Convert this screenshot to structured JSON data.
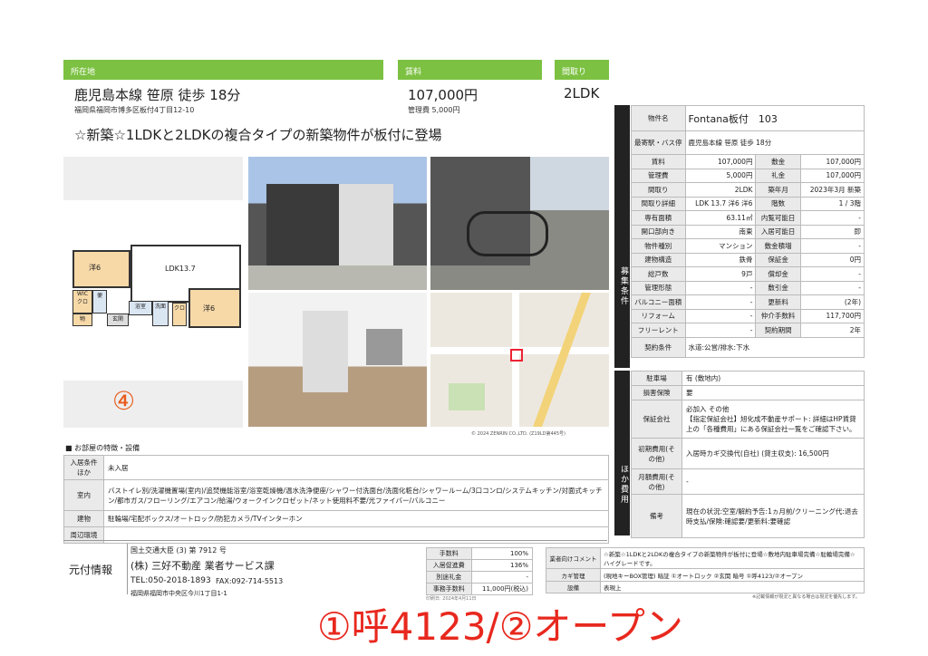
{
  "header": {
    "location_label": "所在地",
    "rent_label": "賃料",
    "layout_label": "間取り",
    "station": "鹿児島本線 笹原 徒歩 18分",
    "address": "福岡県福岡市博多区板付4丁目12-10",
    "rent": "107,000円",
    "admin_fee": "管理費 5,000円",
    "layout": "2LDK",
    "catch": "☆新築☆1LDKと2LDKの複合タイプの新築物件が板付に登場"
  },
  "plan": {
    "room1": "洋6",
    "room2": "LDK13.7",
    "room3": "洋6",
    "wic": "WIC",
    "wic2": "クロ",
    "bath": "浴室",
    "wash": "洗面",
    "toilet": "便",
    "storage": "物",
    "entrance": "玄関",
    "kuro": "クロ",
    "number": "④"
  },
  "map_caption": "© 2024 ZENRIN CO.,LTD. (Z19LD第445号)",
  "side": {
    "recruit": "募集条件",
    "other": "ほか費用"
  },
  "spec": {
    "name_label": "物件名",
    "name": "Fontana板付　103",
    "station_label": "最寄駅・バス停",
    "station": "鹿児島本線 笹原 徒歩 18分",
    "rows": [
      [
        "賃料",
        "107,000円",
        "敷金",
        "107,000円"
      ],
      [
        "管理費",
        "5,000円",
        "礼金",
        "107,000円"
      ],
      [
        "間取り",
        "2LDK",
        "築年月",
        "2023年3月 新築"
      ],
      [
        "間取り詳細",
        "LDK 13.7 洋6 洋6",
        "階数",
        "1 / 3階"
      ],
      [
        "専有面積",
        "63.11㎡",
        "内覧可能日",
        "-"
      ],
      [
        "開口部向き",
        "南東",
        "入居可能日",
        "即"
      ],
      [
        "物件種別",
        "マンション",
        "敷金積増",
        "-"
      ],
      [
        "建物構造",
        "鉄骨",
        "保証金",
        "0円"
      ],
      [
        "総戸数",
        "9戸",
        "償却金",
        "-"
      ],
      [
        "管理形態",
        "-",
        "敷引金",
        "-"
      ],
      [
        "バルコニー面積",
        "-",
        "更新料",
        "(2年)"
      ],
      [
        "リフォーム",
        "-",
        "仲介手数料",
        "117,700円"
      ],
      [
        "フリーレント",
        "-",
        "契約期間",
        "2年"
      ]
    ],
    "contract_label": "契約条件",
    "contract": "水道:公営/排水:下水"
  },
  "other": {
    "parking_label": "駐車場",
    "parking": "有 (敷地内)",
    "insurance_label": "損害保険",
    "insurance": "要",
    "guarantee_label": "保証会社",
    "guarantee": "必加入 その他\n【指定保証会社】旭化成不動産サポート: 詳細はHP賃貸上の「各種費用」にある保証会社一覧をご確認下さい。",
    "initial_label": "初期費用(その他)",
    "initial": "入居時カギ交換代(自社) (貸主収支): 16,500円",
    "monthly_label": "月額費用(その他)",
    "monthly": "-",
    "note_label": "備考",
    "note": "現在の状況:空室/解約予告:1ヵ月前/クリーニング代:退去時支払/保険:確認要/更新料:要確認"
  },
  "features": {
    "title": "■ お部屋の特徴・設備",
    "rows": [
      [
        "入居条件ほか",
        "未入居"
      ],
      [
        "室内",
        "バストイレ別/洗濯機置場(室内)/追焚機能浴室/浴室乾燥機/温水洗浄便座/シャワー付洗面台/洗面化粧台/シャワールーム/3口コンロ/システムキッチン/対面式キッチン/都市ガス/フローリング/エアコン/給湯/ウォークインクロゼット/ネット使用料不要/光ファイバー/バルコニー"
      ],
      [
        "建物",
        "駐輪場/宅配ボックス/オートロック/防犯カメラ/TVインターホン"
      ],
      [
        "周辺環境",
        ""
      ]
    ]
  },
  "agent": {
    "label": "元付情報",
    "license": "国土交通大臣 (3) 第 7912 号",
    "name": "(株) 三好不動産 業者サービス課",
    "tel": "TEL:050-2018-1893",
    "fax": "FAX:092-714-5513",
    "office": "福岡県福岡市中央区今川1丁目1-1"
  },
  "fee": {
    "rows": [
      [
        "手数料",
        "100%"
      ],
      [
        "入居促進費",
        "136%"
      ],
      [
        "別途礼金",
        "-"
      ],
      [
        "事務手数料",
        "11,000円(税込)"
      ]
    ]
  },
  "comment": {
    "label1": "業者向けコメント",
    "text1": "☆新築☆1LDKと2LDKの複合タイプの新築物件が板付に登場☆敷地内駐車場完備☆駐輪場完備☆ハイグレードです。",
    "label2": "カギ管理",
    "text2": "(現地キーBOX管理) 暗証 ①オートロック ②玄関 暗号 ①呼4123/②オープン",
    "label3": "設備",
    "text3": "表現上",
    "date": "印刷日: 2024年4月11日",
    "notice": "※記載情報が現況と異なる場合は現況を優先します。"
  },
  "overlay": "①呼4123/②オープン"
}
